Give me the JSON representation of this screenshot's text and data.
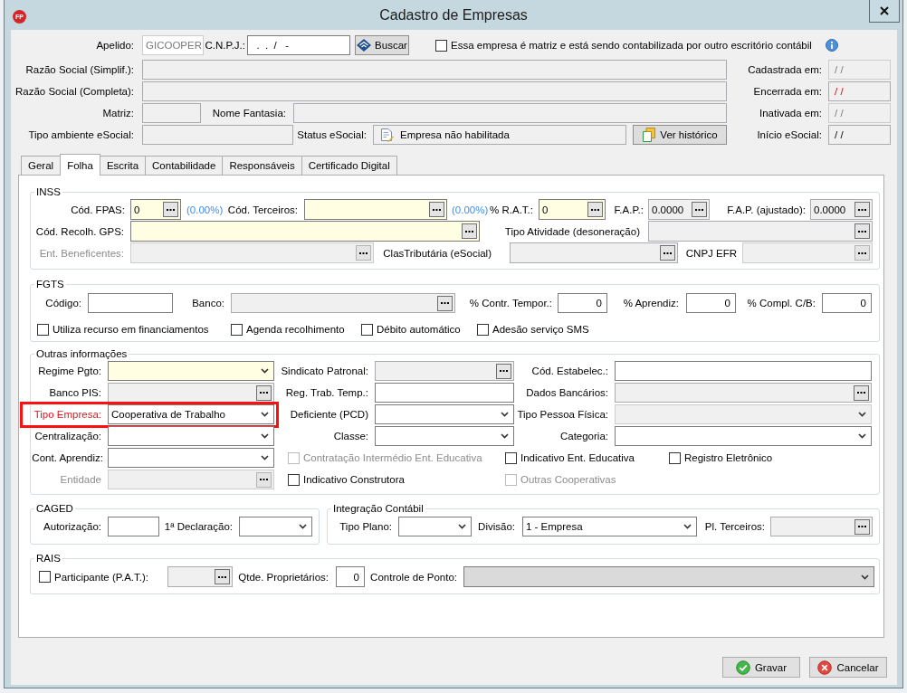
{
  "window": {
    "title": "Cadastro de Empresas",
    "logo_text": "FP"
  },
  "header": {
    "rows": [
      {
        "items": [
          {
            "kind": "text",
            "label": "Apelido:",
            "value": "GICOOPER",
            "required": false,
            "readonly": false,
            "disabled": true,
            "label_disabled": false
          },
          {
            "kind": "text",
            "label": "C.N.P.J.:",
            "value": "  .  .  /   -",
            "required": false,
            "readonly": false,
            "disabled": false,
            "label_disabled": false
          },
          {
            "kind": "button",
            "label": "Buscar"
          },
          {
            "kind": "checkbox",
            "label": "Essa empresa é matriz e está sendo contabilizada por outro escritório contábil",
            "checked": false,
            "disabled": false
          },
          {
            "kind": "info"
          }
        ]
      },
      {
        "items": [
          {
            "kind": "text",
            "label": "Razão Social (Simplif.):",
            "required": false,
            "readonly": true,
            "disabled": false,
            "label_disabled": false
          },
          {
            "kind": "date",
            "label": "Cadastrada em:",
            "value": "/ /",
            "required": false,
            "readonly": true,
            "disabled": true,
            "label_disabled": false,
            "warning": false
          }
        ]
      },
      {
        "items": [
          {
            "kind": "text",
            "label": "Razão Social (Completa):",
            "required": false,
            "readonly": true,
            "disabled": false,
            "label_disabled": false
          },
          {
            "kind": "date",
            "label": "Encerrada em:",
            "value": "/ /",
            "required": false,
            "readonly": true,
            "disabled": false,
            "label_disabled": false,
            "warning": true
          }
        ]
      },
      {
        "items": [
          {
            "kind": "text",
            "label": "Matriz:",
            "required": false,
            "readonly": true,
            "disabled": false,
            "label_disabled": false
          },
          {
            "kind": "text",
            "label": "Nome Fantasia:",
            "required": false,
            "readonly": true,
            "disabled": false,
            "label_disabled": false
          },
          {
            "kind": "date",
            "label": "Inativada em:",
            "value": "/ /",
            "required": false,
            "readonly": true,
            "disabled": true,
            "label_disabled": false,
            "warning": false
          }
        ]
      },
      {
        "items": [
          {
            "kind": "text",
            "label": "Tipo ambiente eSocial:",
            "required": false,
            "readonly": true,
            "disabled": false,
            "label_disabled": false
          },
          {
            "kind": "status",
            "label": "Status eSocial:",
            "value": "Empresa não habilitada",
            "required": false,
            "readonly": true,
            "disabled": false,
            "label_disabled": false
          },
          {
            "kind": "button",
            "label": "Ver histórico"
          },
          {
            "kind": "date",
            "label": "Início eSocial:",
            "value": "/ /",
            "required": false,
            "readonly": true,
            "disabled": false,
            "label_disabled": false,
            "warning": false
          }
        ]
      }
    ]
  },
  "tabs": [
    {
      "label": "Geral",
      "selected": false
    },
    {
      "label": "Folha",
      "selected": true
    },
    {
      "label": "Escrita",
      "selected": false
    },
    {
      "label": "Contabilidade",
      "selected": false
    },
    {
      "label": "Responsáveis",
      "selected": false
    },
    {
      "label": "Certificado Digital",
      "selected": false
    }
  ],
  "groups": [
    {
      "title": "INSS",
      "rows": [
        {
          "items": [
            {
              "kind": "lookup",
              "label": "Cód. FPAS:",
              "value": "0",
              "required": true,
              "readonly": false,
              "disabled": false,
              "label_disabled": false
            },
            {
              "kind": "note",
              "text": "(0.00%)"
            },
            {
              "kind": "lookup",
              "label": "Cód. Terceiros:",
              "required": true,
              "readonly": false,
              "disabled": false,
              "label_disabled": false
            },
            {
              "kind": "note",
              "text": "(0.00%)"
            },
            {
              "kind": "lookup",
              "label": "% R.A.T.:",
              "value": "0",
              "required": true,
              "readonly": false,
              "disabled": false,
              "label_disabled": false
            },
            {
              "kind": "lookup",
              "label": "F.A.P.:",
              "value": "0.0000",
              "required": false,
              "readonly": true,
              "disabled": false,
              "label_disabled": false
            },
            {
              "kind": "lookup",
              "label": "F.A.P. (ajustado):",
              "value": "0.0000",
              "required": false,
              "readonly": true,
              "disabled": false,
              "label_disabled": false
            }
          ]
        },
        {
          "items": [
            {
              "kind": "lookup",
              "label": "Cód. Recolh. GPS:",
              "required": true,
              "readonly": false,
              "disabled": false,
              "label_disabled": false
            },
            {
              "kind": "lookup",
              "label": "Tipo Atividade (desoneração)",
              "required": false,
              "readonly": true,
              "disabled": false,
              "label_disabled": false
            }
          ]
        },
        {
          "items": [
            {
              "kind": "lookup",
              "label": "Ent. Beneficentes:",
              "required": false,
              "readonly": true,
              "disabled": true,
              "label_disabled": true
            },
            {
              "kind": "lookup",
              "label": "ClasTributária (eSocial)",
              "required": false,
              "readonly": true,
              "disabled": false,
              "label_disabled": false
            },
            {
              "kind": "lookup",
              "label": "CNPJ EFR",
              "required": false,
              "readonly": true,
              "disabled": true,
              "label_disabled": false
            }
          ]
        }
      ]
    },
    {
      "title": "FGTS",
      "rows": [
        {
          "items": [
            {
              "kind": "text",
              "label": "Código:",
              "required": false,
              "readonly": false,
              "disabled": false,
              "label_disabled": false
            },
            {
              "kind": "lookup",
              "label": "Banco:",
              "required": false,
              "readonly": true,
              "disabled": false,
              "label_disabled": false
            },
            {
              "kind": "number",
              "label": "% Contr. Tempor.:",
              "value": "0",
              "required": false,
              "readonly": false,
              "disabled": false,
              "label_disabled": false
            },
            {
              "kind": "number",
              "label": "% Aprendiz:",
              "value": "0",
              "required": false,
              "readonly": false,
              "disabled": false,
              "label_disabled": false
            },
            {
              "kind": "number",
              "label": "% Compl. C/B:",
              "value": "0",
              "required": false,
              "readonly": false,
              "disabled": false,
              "label_disabled": false
            }
          ]
        },
        {
          "items": [
            {
              "kind": "checkbox",
              "label": "Utiliza recurso em financiamentos",
              "checked": false,
              "disabled": false
            },
            {
              "kind": "checkbox",
              "label": "Agenda recolhimento",
              "checked": false,
              "disabled": false
            },
            {
              "kind": "checkbox",
              "label": "Débito automático",
              "checked": false,
              "disabled": false
            },
            {
              "kind": "checkbox",
              "label": "Adesão serviço SMS",
              "checked": false,
              "disabled": false
            }
          ]
        }
      ]
    },
    {
      "title": "Outras informações",
      "rows": [
        {
          "items": [
            {
              "kind": "select",
              "label": "Regime Pgto:",
              "required": true,
              "readonly": false,
              "disabled": false,
              "label_disabled": false,
              "highlighted": false
            },
            {
              "kind": "lookup",
              "label": "Sindicato Patronal:",
              "required": false,
              "readonly": true,
              "disabled": false,
              "label_disabled": false,
              "highlighted": false
            },
            {
              "kind": "text",
              "label": "Cód. Estabelec.:",
              "required": false,
              "readonly": false,
              "disabled": false,
              "label_disabled": false,
              "highlighted": false
            }
          ]
        },
        {
          "items": [
            {
              "kind": "lookup",
              "label": "Banco PIS:",
              "required": false,
              "readonly": true,
              "disabled": false,
              "label_disabled": false,
              "highlighted": false
            },
            {
              "kind": "text",
              "label": "Reg. Trab. Temp.:",
              "required": false,
              "readonly": false,
              "disabled": false,
              "label_disabled": false,
              "highlighted": false
            },
            {
              "kind": "lookup",
              "label": "Dados Bancários:",
              "required": false,
              "readonly": true,
              "disabled": false,
              "label_disabled": false,
              "highlighted": false
            }
          ]
        },
        {
          "items": [
            {
              "kind": "select",
              "label": "Tipo Empresa:",
              "value": "Cooperativa de Trabalho",
              "required": false,
              "readonly": false,
              "disabled": false,
              "label_disabled": false,
              "highlighted": true
            },
            {
              "kind": "select",
              "label": "Deficiente (PCD)",
              "required": false,
              "readonly": false,
              "disabled": false,
              "label_disabled": false,
              "highlighted": false
            },
            {
              "kind": "select",
              "label": "Tipo Pessoa Física:",
              "required": false,
              "readonly": false,
              "disabled": true,
              "label_disabled": false,
              "highlighted": false
            }
          ]
        },
        {
          "items": [
            {
              "kind": "select",
              "label": "Centralização:",
              "required": false,
              "readonly": false,
              "disabled": false,
              "label_disabled": false,
              "highlighted": false
            },
            {
              "kind": "select",
              "label": "Classe:",
              "required": false,
              "readonly": false,
              "disabled": false,
              "label_disabled": false,
              "highlighted": false
            },
            {
              "kind": "select",
              "label": "Categoria:",
              "required": false,
              "readonly": false,
              "disabled": false,
              "label_disabled": false,
              "highlighted": false
            }
          ]
        },
        {
          "items": [
            {
              "kind": "select",
              "label": "Cont. Aprendiz:",
              "required": false,
              "readonly": false,
              "disabled": false,
              "label_disabled": false,
              "highlighted": false
            },
            {
              "kind": "checkbox",
              "label": "Contratação Intermédio Ent. Educativa",
              "checked": false,
              "disabled": true
            },
            {
              "kind": "checkbox",
              "label": "Indicativo Ent. Educativa",
              "checked": false,
              "disabled": false
            },
            {
              "kind": "checkbox",
              "label": "Registro Eletrônico",
              "checked": false,
              "disabled": false
            }
          ]
        },
        {
          "items": [
            {
              "kind": "lookup",
              "label": "Entidade",
              "required": false,
              "readonly": true,
              "disabled": true,
              "label_disabled": true,
              "highlighted": false
            },
            {
              "kind": "checkbox",
              "label": "Indicativo Construtora",
              "checked": false,
              "disabled": false
            },
            {
              "kind": "checkbox",
              "label": "Outras Cooperativas",
              "checked": false,
              "disabled": true
            }
          ]
        }
      ]
    },
    {
      "title": "CAGED",
      "rows": [
        {
          "items": [
            {
              "kind": "text",
              "label": "Autorização:",
              "required": false,
              "readonly": false,
              "disabled": false,
              "label_disabled": false
            },
            {
              "kind": "select",
              "label": "1ª Declaração:",
              "required": false,
              "readonly": false,
              "disabled": false,
              "label_disabled": false
            }
          ]
        }
      ]
    },
    {
      "title": "Integração Contábil",
      "rows": [
        {
          "items": [
            {
              "kind": "select",
              "label": "Tipo Plano:",
              "required": false,
              "readonly": false,
              "disabled": false,
              "label_disabled": false
            },
            {
              "kind": "select",
              "label": "Divisão:",
              "value": "1 - Empresa",
              "required": false,
              "readonly": false,
              "disabled": false,
              "label_disabled": false
            },
            {
              "kind": "lookup",
              "label": "Pl. Terceiros:",
              "required": false,
              "readonly": true,
              "disabled": false,
              "label_disabled": false
            }
          ]
        }
      ]
    },
    {
      "title": "RAIS",
      "rows": [
        {
          "items": [
            {
              "kind": "checkbox",
              "label": "Participante (P.A.T.):",
              "checked": false,
              "disabled": false
            },
            {
              "kind": "lookup",
              "required": false,
              "readonly": true,
              "disabled": false
            },
            {
              "kind": "number",
              "label": "Qtde. Proprietários:",
              "value": "0",
              "required": false,
              "readonly": false,
              "disabled": false,
              "label_disabled": false
            },
            {
              "kind": "select",
              "label": "Controle de Ponto:",
              "required": false,
              "readonly": true,
              "disabled": false,
              "label_disabled": false
            }
          ]
        }
      ]
    }
  ],
  "buttons": [
    {
      "label": "Gravar"
    },
    {
      "label": "Cancelar"
    }
  ]
}
